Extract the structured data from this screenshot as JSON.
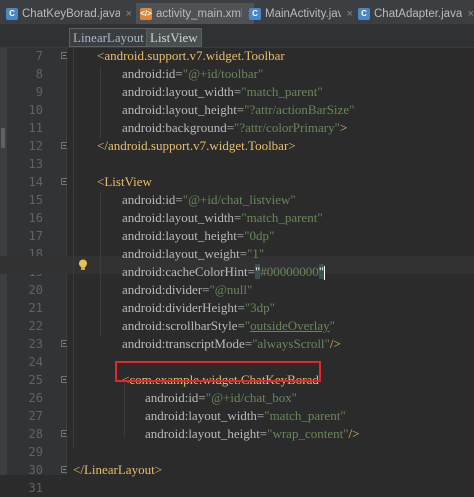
{
  "tabs": [
    {
      "label": "ChatKeyBorad.java",
      "icon": "java-class-icon",
      "active": false
    },
    {
      "label": "activity_main.xml",
      "icon": "xml-file-icon",
      "active": true
    },
    {
      "label": "MainActivity.java",
      "icon": "java-class-icon",
      "active": false
    },
    {
      "label": "ChatAdapter.java",
      "icon": "java-class-icon",
      "active": false
    }
  ],
  "close_glyph": "×",
  "breadcrumb": [
    "LinearLayout",
    "ListView"
  ],
  "lines": [
    {
      "n": "7",
      "parts": [
        {
          "t": "<android.support.v7.widget.Toolbar",
          "c": "tag"
        }
      ]
    },
    {
      "n": "8",
      "parts": [
        {
          "t": "android:id=",
          "c": "attr"
        },
        {
          "t": "\"@+id/toolbar\"",
          "c": "val"
        }
      ]
    },
    {
      "n": "9",
      "parts": [
        {
          "t": "android:layout_width=",
          "c": "attr"
        },
        {
          "t": "\"match_parent\"",
          "c": "val"
        }
      ]
    },
    {
      "n": "10",
      "parts": [
        {
          "t": "android:layout_height=",
          "c": "attr"
        },
        {
          "t": "\"?attr/actionBarSize\"",
          "c": "val"
        }
      ]
    },
    {
      "n": "11",
      "parts": [
        {
          "t": "android:background=",
          "c": "attr"
        },
        {
          "t": "\"?attr/colorPrimary\"",
          "c": "val"
        },
        {
          "t": ">",
          "c": "tag"
        }
      ]
    },
    {
      "n": "12",
      "parts": [
        {
          "t": "</android.support.v7.widget.Toolbar>",
          "c": "tag"
        }
      ]
    },
    {
      "n": "13",
      "parts": []
    },
    {
      "n": "14",
      "parts": [
        {
          "t": "<ListView",
          "c": "tag"
        }
      ]
    },
    {
      "n": "15",
      "parts": [
        {
          "t": "android:id=",
          "c": "attr"
        },
        {
          "t": "\"@+id/chat_listview\"",
          "c": "val"
        }
      ]
    },
    {
      "n": "16",
      "parts": [
        {
          "t": "android:layout_width=",
          "c": "attr"
        },
        {
          "t": "\"match_parent\"",
          "c": "val"
        }
      ]
    },
    {
      "n": "17",
      "parts": [
        {
          "t": "android:layout_height=",
          "c": "attr"
        },
        {
          "t": "\"0dp\"",
          "c": "val"
        }
      ]
    },
    {
      "n": "18",
      "parts": [
        {
          "t": "android:layout_weight=",
          "c": "attr"
        },
        {
          "t": "\"1\"",
          "c": "val"
        }
      ]
    },
    {
      "n": "19",
      "parts": [
        {
          "t": "android:cacheColorHint=",
          "c": "attr"
        },
        {
          "t": "\"",
          "c": "hl"
        },
        {
          "t": "#00000000",
          "c": "val"
        },
        {
          "t": "\"",
          "c": "hl"
        }
      ]
    },
    {
      "n": "20",
      "parts": [
        {
          "t": "android:divider=",
          "c": "attr"
        },
        {
          "t": "\"@null\"",
          "c": "val"
        }
      ]
    },
    {
      "n": "21",
      "parts": [
        {
          "t": "android:dividerHeight=",
          "c": "attr"
        },
        {
          "t": "\"3dp\"",
          "c": "val"
        }
      ]
    },
    {
      "n": "22",
      "parts": [
        {
          "t": "android:scrollbarStyle=",
          "c": "attr"
        },
        {
          "t": "\"",
          "c": "val"
        },
        {
          "t": "outsideOverlay",
          "c": "link"
        },
        {
          "t": "\"",
          "c": "val"
        }
      ]
    },
    {
      "n": "23",
      "parts": [
        {
          "t": "android:transcriptMode=",
          "c": "attr"
        },
        {
          "t": "\"alwaysScroll\"",
          "c": "val"
        },
        {
          "t": "/>",
          "c": "tag"
        }
      ]
    },
    {
      "n": "24",
      "parts": []
    },
    {
      "n": "25",
      "parts": [
        {
          "t": "<com.example.widget.ChatKeyBorad",
          "c": "tag"
        }
      ]
    },
    {
      "n": "26",
      "parts": [
        {
          "t": "android:id=",
          "c": "attr"
        },
        {
          "t": "\"@+id/chat_box\"",
          "c": "val"
        }
      ]
    },
    {
      "n": "27",
      "parts": [
        {
          "t": "android:layout_width=",
          "c": "attr"
        },
        {
          "t": "\"match_parent\"",
          "c": "val"
        }
      ]
    },
    {
      "n": "28",
      "parts": [
        {
          "t": "android:layout_height=",
          "c": "attr"
        },
        {
          "t": "\"wrap_content\"",
          "c": "val"
        },
        {
          "t": "/>",
          "c": "tag"
        }
      ]
    },
    {
      "n": "29",
      "parts": []
    },
    {
      "n": "30",
      "parts": [
        {
          "t": "</LinearLayout>",
          "c": "tag"
        }
      ]
    },
    {
      "n": "31",
      "parts": []
    }
  ],
  "colors": {
    "background": "#2b2b2b",
    "tag": "#e8bf6a",
    "attribute": "#bababa",
    "value": "#6a8759",
    "line_number": "#606366",
    "highlight_box": "#e8252a"
  }
}
